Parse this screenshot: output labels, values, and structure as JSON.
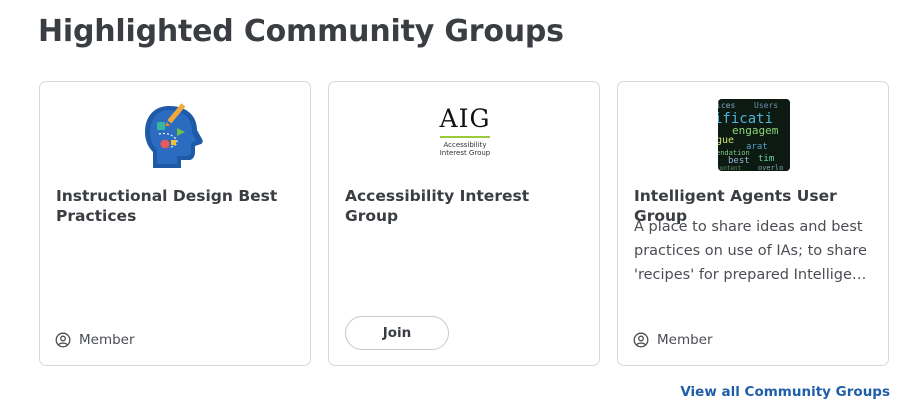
{
  "section": {
    "title": "Highlighted Community Groups",
    "view_all_label": "View all Community Groups"
  },
  "groups": [
    {
      "title": "Instructional Design Best Practices",
      "description": "",
      "status": "Member",
      "logo": "head-puzzle-icon"
    },
    {
      "title": "Accessibility Interest Group",
      "description": "",
      "action_label": "Join",
      "logo_text": "AIG",
      "logo_subtext_line1": "Accessibility",
      "logo_subtext_line2": "Interest Group",
      "logo": "aig-logo"
    },
    {
      "title": "Intelligent Agents User Group",
      "description": "A place to share ideas and best practices on use of IAs; to share 'recipes' for prepared Intelligent Agents",
      "status": "Member",
      "logo": "word-cloud-image"
    }
  ],
  "colors": {
    "link": "#1f5fa8",
    "border": "#d6d8dc",
    "heading": "#3a3d42",
    "accent_green": "#9acb3c"
  }
}
